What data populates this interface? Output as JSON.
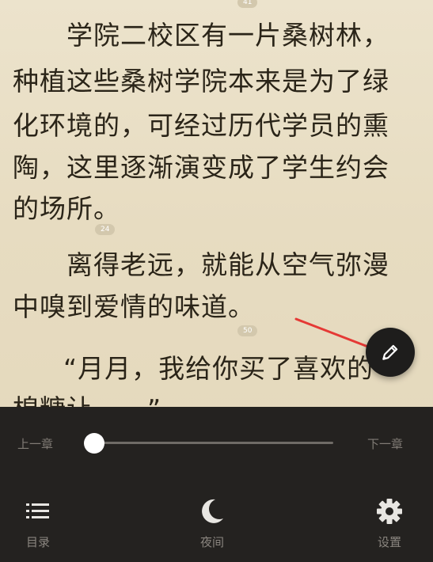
{
  "reader": {
    "lines": [
      "学院二校区有一片桑树林，",
      "种植这些桑树学院本来是为了绿",
      "化环境的，可经过历代学员的熏",
      "陶，这里逐渐演变成了学生约会",
      "的场所。",
      "离得老远，就能从空气弥漫",
      "中嗅到爱情的味道。",
      "“月月，我给你买了喜欢的",
      "棉糖让……”"
    ],
    "badges": [
      "41",
      "24",
      "50"
    ]
  },
  "fab": {
    "icon": "pencil-icon"
  },
  "progress": {
    "prev_label": "上一章",
    "next_label": "下一章",
    "value": 0
  },
  "bottom_nav": [
    {
      "label": "目录",
      "icon": "list-icon"
    },
    {
      "label": "夜间",
      "icon": "moon-icon"
    },
    {
      "label": "设置",
      "icon": "gear-icon"
    }
  ],
  "colors": {
    "page_bg": "#e7dcc1",
    "text": "#2a2418",
    "panel_bg": "#242220",
    "accent_arrow": "#e53935"
  }
}
